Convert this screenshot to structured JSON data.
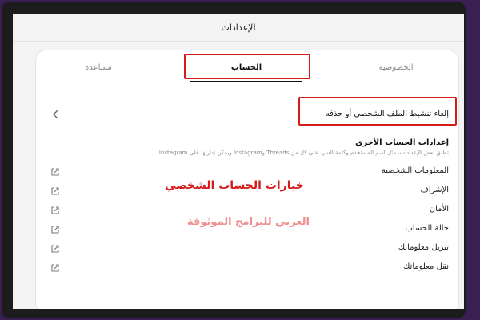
{
  "screen": {
    "title": "الإعدادات"
  },
  "tabs": [
    {
      "label": "الخصوصية"
    },
    {
      "label": "الحساب"
    },
    {
      "label": "مساعدة"
    }
  ],
  "deactivate": {
    "label": "إلغاء تنشيط الملف الشخصي أو حذفه"
  },
  "other_settings": {
    "title": "إعدادات الحساب الأخرى",
    "description": "تطبق بعض الإعدادات، مثل اسم المستخدم وكلمة السر، على كل من Threads وInstagram ويمكن إدارتها على Instagram.",
    "items": [
      {
        "label": "المعلومات الشخصية"
      },
      {
        "label": "الإشراف"
      },
      {
        "label": "الأمان"
      },
      {
        "label": "حالة الحساب"
      },
      {
        "label": "تنزيل معلوماتك"
      },
      {
        "label": "نقل معلوماتك"
      }
    ]
  },
  "overlays": {
    "caption": "خيارات الحساب الشخصي",
    "watermark": "العربي للبرامج الموثوقة"
  },
  "colors": {
    "highlight": "#d51a1a",
    "caption": "#d41c1c",
    "watermark": "#ee8d8d",
    "frame": "#3a1f52"
  }
}
